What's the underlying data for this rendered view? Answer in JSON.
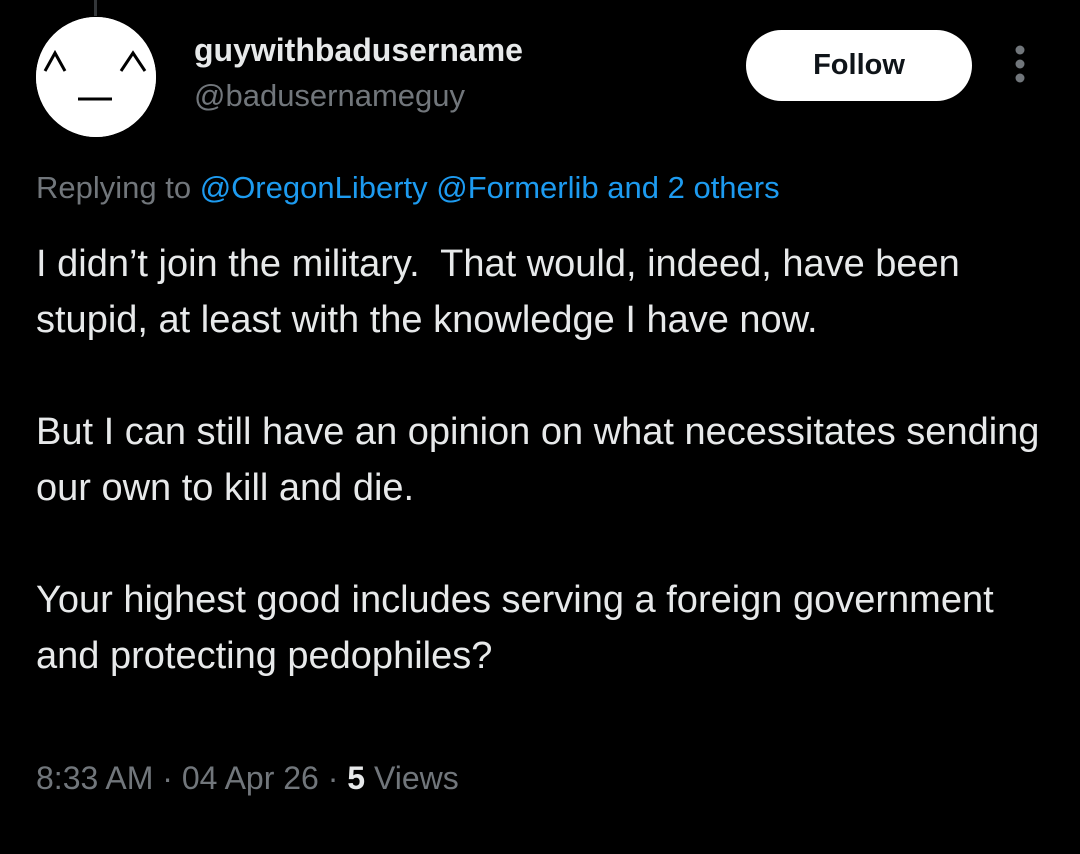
{
  "author": {
    "display_name": "guywithbadusername",
    "handle": "@badusernameguy",
    "avatar_icon": "kaomoji-face-avatar"
  },
  "actions": {
    "follow_label": "Follow",
    "more_icon": "more-vertical-icon"
  },
  "reply": {
    "prefix": "Replying to ",
    "mention_1": "@OregonLiberty",
    "mention_2": "@Formerlib",
    "others": "and 2 others"
  },
  "post": {
    "paragraphs": [
      "I didn’t join the military.  That would, indeed, have been stupid, at least with the knowledge I have now.",
      "But I can still have an opinion on what necessitates sending our own to kill and die.",
      "Your highest good includes serving a foreign government and protecting pedophiles?"
    ]
  },
  "meta": {
    "time": "8:33 AM",
    "sep1": " · ",
    "date": "04 Apr 26",
    "sep2": " · ",
    "views_count": "5",
    "views_label": " Views"
  },
  "colors": {
    "background": "#000000",
    "primary_text": "#e7e9ea",
    "secondary_text": "#71767b",
    "link": "#1d9bf0",
    "follow_bg": "#ffffff"
  }
}
